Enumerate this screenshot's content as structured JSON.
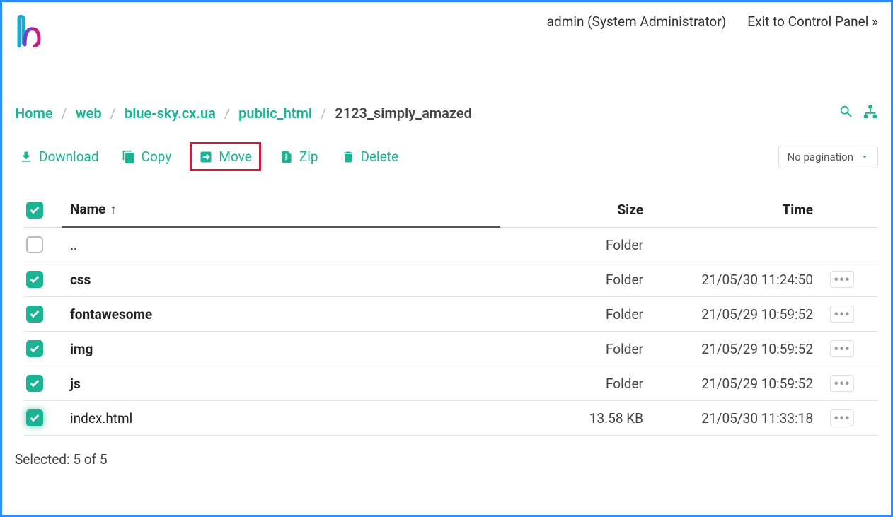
{
  "header": {
    "user_label": "admin (System Administrator)",
    "exit_label": "Exit to Control Panel »"
  },
  "breadcrumb": {
    "items": [
      "Home",
      "web",
      "blue-sky.cx.ua",
      "public_html",
      "2123_simply_amazed"
    ]
  },
  "toolbar": {
    "download": "Download",
    "copy": "Copy",
    "move": "Move",
    "zip": "Zip",
    "delete": "Delete",
    "pagination": "No pagination"
  },
  "columns": {
    "name": "Name",
    "size": "Size",
    "time": "Time"
  },
  "rows": [
    {
      "checked": false,
      "name": "..",
      "type": "parent",
      "size": "Folder",
      "time": ""
    },
    {
      "checked": true,
      "name": "css",
      "type": "folder",
      "size": "Folder",
      "time": "21/05/30 11:24:50"
    },
    {
      "checked": true,
      "name": "fontawesome",
      "type": "folder",
      "size": "Folder",
      "time": "21/05/29 10:59:52"
    },
    {
      "checked": true,
      "name": "img",
      "type": "folder",
      "size": "Folder",
      "time": "21/05/29 10:59:52"
    },
    {
      "checked": true,
      "name": "js",
      "type": "folder",
      "size": "Folder",
      "time": "21/05/29 10:59:52"
    },
    {
      "checked": true,
      "glow": true,
      "name": "index.html",
      "type": "file",
      "size": "13.58 KB",
      "time": "21/05/30 11:33:18"
    }
  ],
  "status": "Selected: 5 of 5"
}
